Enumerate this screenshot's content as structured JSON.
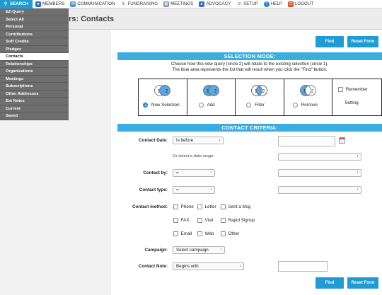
{
  "nav": {
    "items": [
      {
        "label": "SEARCH",
        "icon": "search-icon"
      },
      {
        "label": "MEMBERS",
        "icon": "members-icon"
      },
      {
        "label": "COMMUNICATION",
        "icon": "envelope-icon"
      },
      {
        "label": "FUNDRAISING",
        "icon": "dollar-icon"
      },
      {
        "label": "MEETINGS",
        "icon": "calendar-icon"
      },
      {
        "label": "ADVOCACY",
        "icon": "megaphone-icon"
      },
      {
        "label": "SETUP",
        "icon": "gear-icon"
      },
      {
        "label": "HELP",
        "icon": "help-icon"
      },
      {
        "label": "LOGOUT",
        "icon": "logout-icon"
      }
    ]
  },
  "page": {
    "title": "rs: Contacts"
  },
  "menu": {
    "items": [
      "EZ-Query",
      "Select All",
      "Personal",
      "Contributions",
      "Soft Credits",
      "Pledges",
      "Contacts",
      "Relationships",
      "Organizations",
      "Meetings",
      "Subscriptions",
      "Other Addresses",
      "Ext Notes",
      "Current",
      "Saved"
    ],
    "selected": "Contacts"
  },
  "buttons": {
    "find": "Find",
    "reset": "Reset Form"
  },
  "selection": {
    "header": "SELECTION MODE:",
    "instruction1": "Choose how this new query (circle 2) will relate to the existing selection (circle 1).",
    "instruction2": "The blue area represents the list that will result when you click the \"Find\" button.",
    "options": [
      "New Selection",
      "Add",
      "Filter",
      "Remove"
    ],
    "selected": "New Selection",
    "remember1": "Remember",
    "remember2": "Setting",
    "circle1": "1",
    "circle2": "2"
  },
  "criteria": {
    "header": "CONTACT CRITERIA:",
    "date_label": "Contact Date:",
    "date_op": "Is before",
    "date_range_hint": "Or select a date range:",
    "by_label": "Contact by:",
    "by_op": "=",
    "type_label": "Contact type:",
    "type_op": "=",
    "method_label": "Contact method:",
    "methods": [
      "Phone",
      "Letter",
      "Sent a Msg",
      "FAX",
      "Visit",
      "Rapid Signup",
      "Email",
      "Web",
      "Other"
    ],
    "campaign_label": "Campaign:",
    "campaign_value": "Select campaign",
    "note_label": "Contact Note:",
    "note_op": "Begins with"
  },
  "colors": {
    "accent": "#1f9bd6",
    "band": "#3aaee0",
    "menu": "#6e6e6e",
    "venn_fill": "#5aa6e0"
  }
}
